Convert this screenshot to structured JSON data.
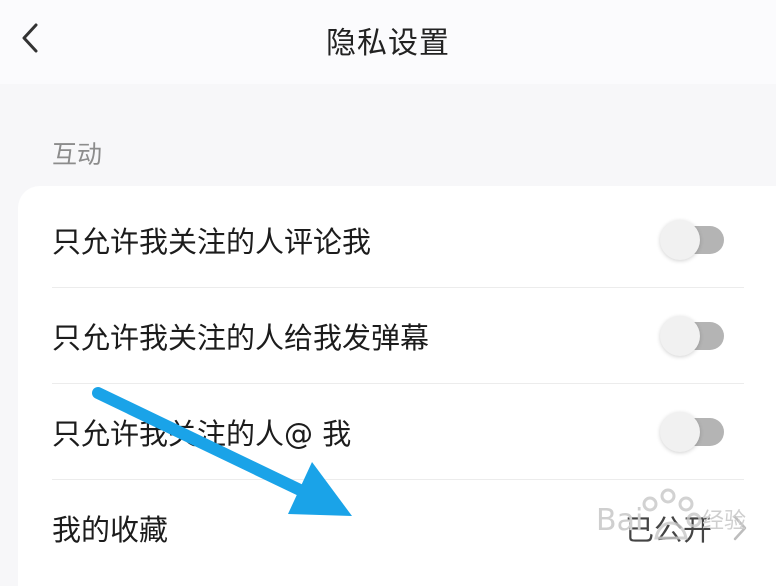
{
  "header": {
    "title": "隐私设置",
    "back_icon": "chevron-left-icon"
  },
  "section": {
    "label": "互动"
  },
  "rows": [
    {
      "label": "只允许我关注的人评论我",
      "toggle_on": false
    },
    {
      "label": "只允许我关注的人给我发弹幕",
      "toggle_on": false
    },
    {
      "label": "只允许我关注的人@ 我",
      "toggle_on": false
    },
    {
      "label": "我的收藏",
      "value": "已公开"
    }
  ],
  "overlay": {
    "arrow_color": "#1aa3e8",
    "watermark_text": "Bai 经验"
  },
  "colors": {
    "background": "#f7f7f9",
    "card": "#ffffff",
    "toggle_track_off": "#b4b4b4",
    "toggle_knob": "#f1f1f1"
  }
}
